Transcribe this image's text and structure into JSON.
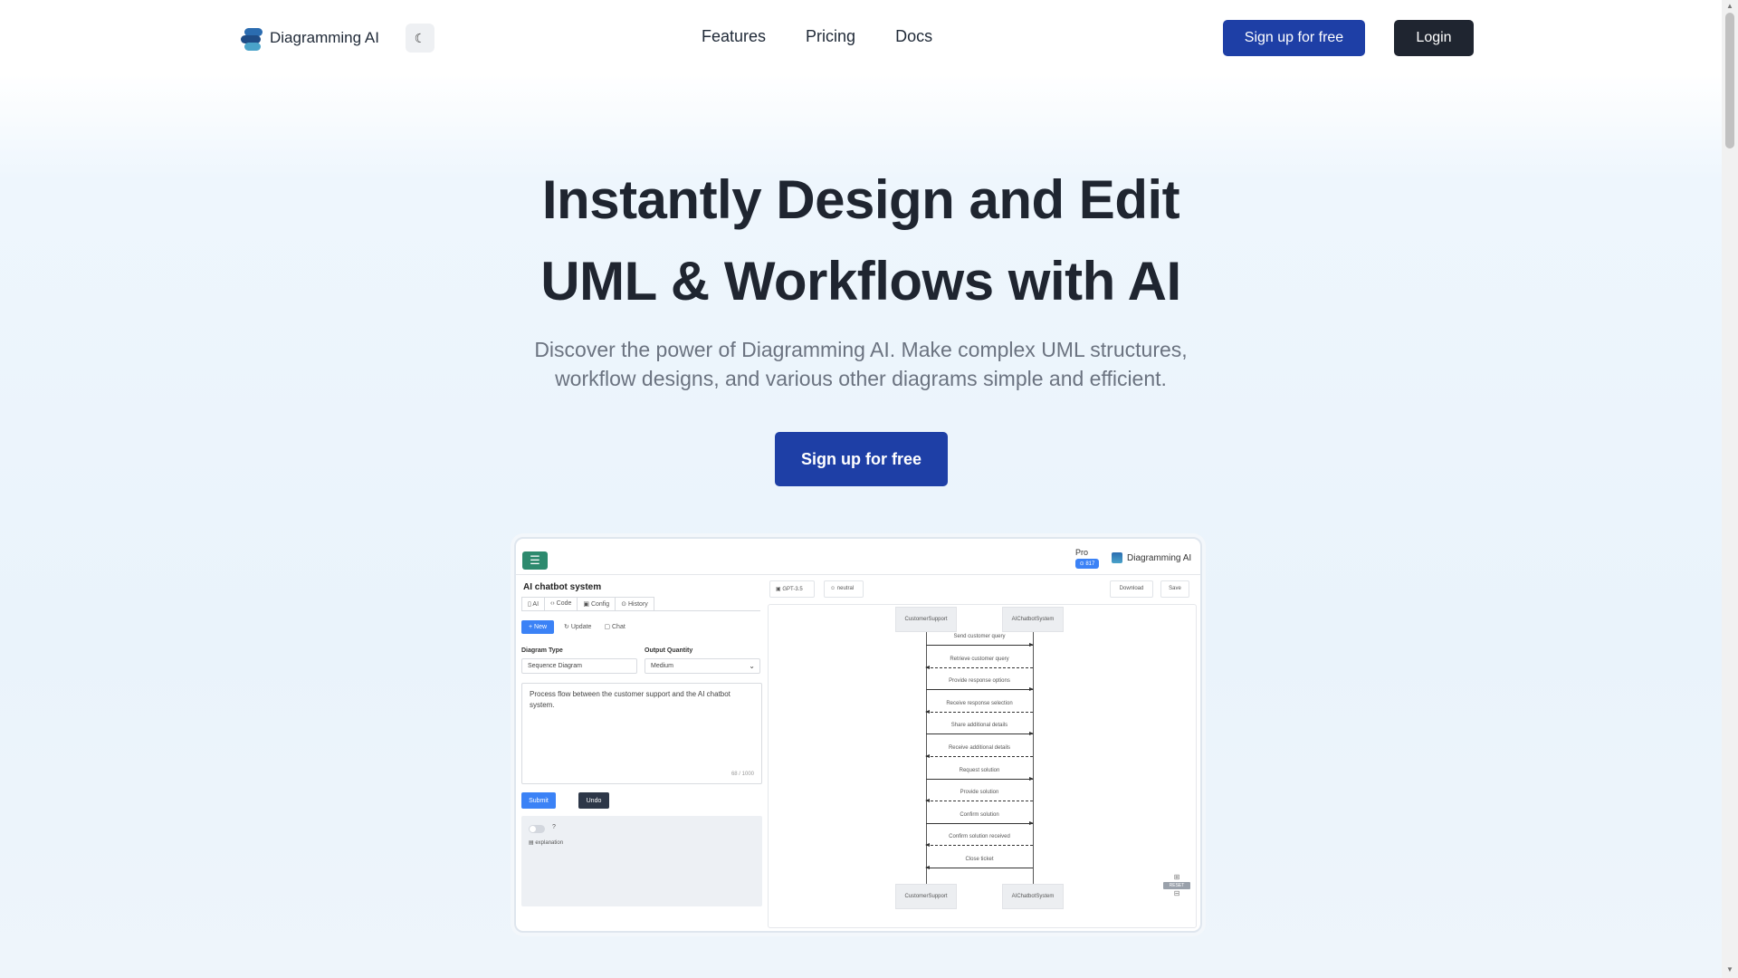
{
  "header": {
    "brand": "Diagramming AI",
    "theme_icon": "moon-icon",
    "nav": [
      "Features",
      "Pricing",
      "Docs"
    ],
    "signup_label": "Sign up for free",
    "login_label": "Login"
  },
  "hero": {
    "title_line1": "Instantly Design and Edit",
    "title_line2": "UML & Workflows with AI",
    "subtitle": "Discover the power of Diagramming AI. Make complex UML structures, workflow designs, and various other diagrams simple and efficient.",
    "cta_label": "Sign up for free"
  },
  "preview": {
    "plan": "Pro",
    "plan_badge": "⊙ 817",
    "brand": "Diagramming AI",
    "project_title": "AI chatbot system",
    "tabs": [
      "AI",
      "Code",
      "Config",
      "History"
    ],
    "actions": {
      "new": "+ New",
      "update": "Update",
      "chat": "Chat"
    },
    "diagram_type_label": "Diagram Type",
    "diagram_type_value": "Sequence Diagram",
    "output_quantity_label": "Output Quantity",
    "output_quantity_value": "Medium",
    "prompt": "Process flow between the customer support and the AI chatbot system.",
    "char_count": "68 / 1000",
    "submit_label": "Submit",
    "undo_label": "Undo",
    "toggle_label": "?",
    "explanation_label": "explanation",
    "model_chip": "GPT-3.5",
    "tone_chip": "neutral",
    "download_label": "Download",
    "save_label": "Save",
    "reset_label": "RESET",
    "actors": [
      "CustomerSupport",
      "AIChatbotSystem"
    ],
    "messages": [
      {
        "label": "Send customer query",
        "dir": "right",
        "dashed": false
      },
      {
        "label": "Retrieve customer query",
        "dir": "left",
        "dashed": true
      },
      {
        "label": "Provide response options",
        "dir": "right",
        "dashed": false
      },
      {
        "label": "Receive response selection",
        "dir": "left",
        "dashed": true
      },
      {
        "label": "Share additional details",
        "dir": "right",
        "dashed": false
      },
      {
        "label": "Receive additional details",
        "dir": "left",
        "dashed": true
      },
      {
        "label": "Request solution",
        "dir": "right",
        "dashed": false
      },
      {
        "label": "Provide solution",
        "dir": "left",
        "dashed": true
      },
      {
        "label": "Confirm solution",
        "dir": "right",
        "dashed": false
      },
      {
        "label": "Confirm solution received",
        "dir": "left",
        "dashed": true
      },
      {
        "label": "Close ticket",
        "dir": "left",
        "dashed": false
      }
    ]
  },
  "colors": {
    "primary": "#1e3fa6",
    "dark": "#1f2530",
    "accent_blue": "#3b82f6",
    "menu_green": "#2d8a6e"
  }
}
